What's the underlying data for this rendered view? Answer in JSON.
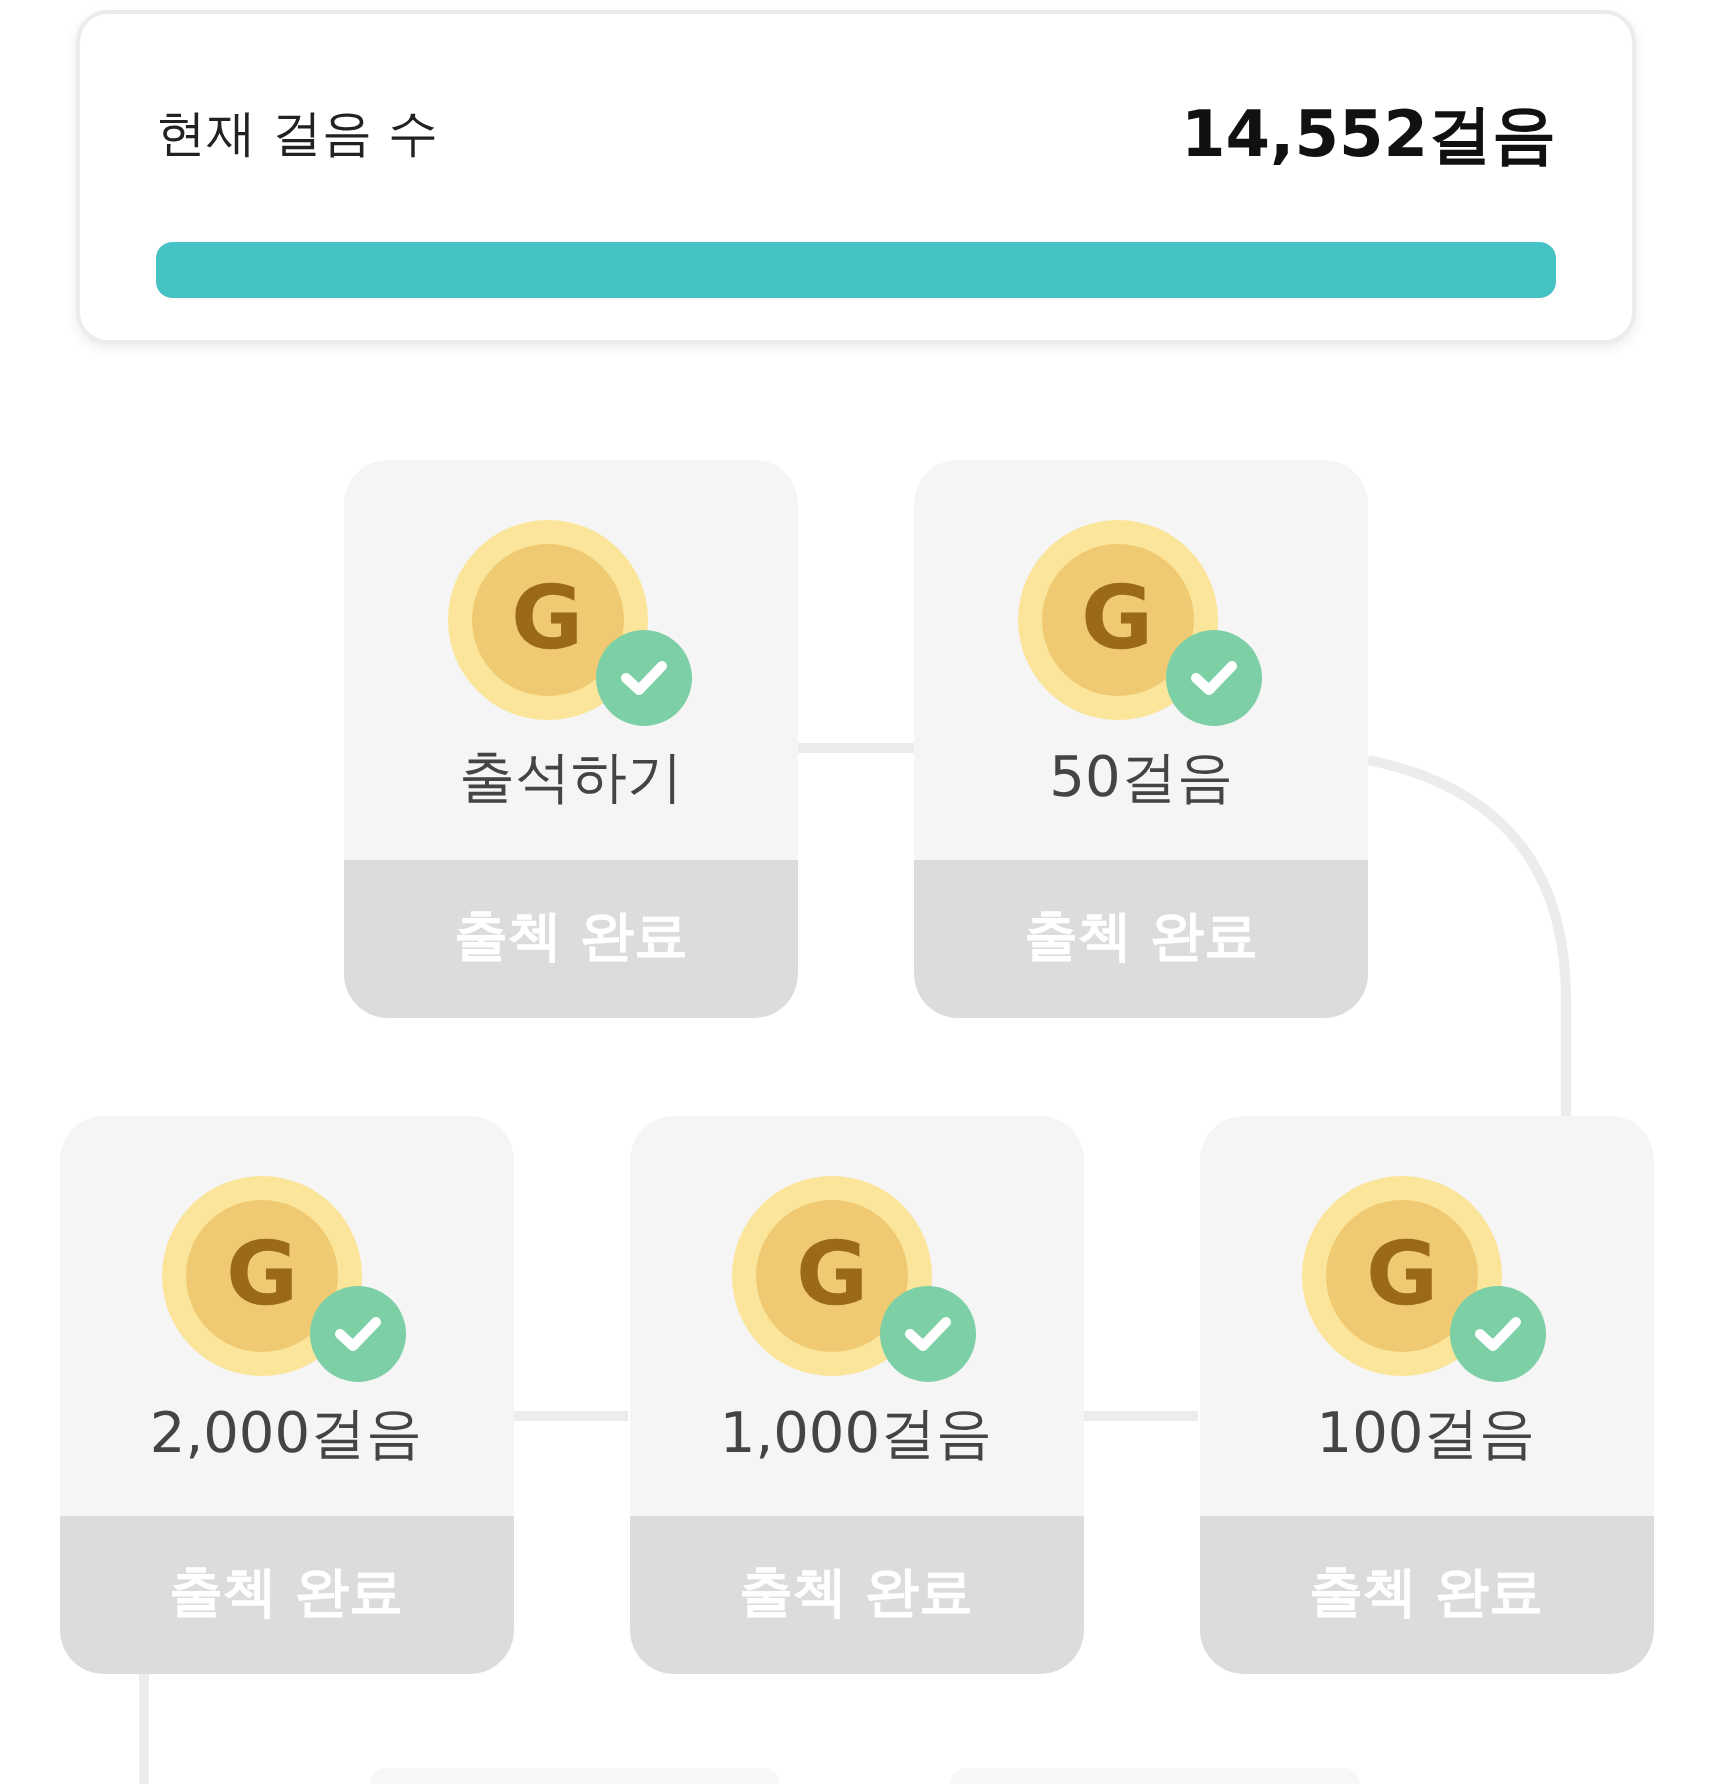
{
  "summary": {
    "label": "현재 걸음 수",
    "value": "14,552걸음",
    "level": 1.0
  },
  "rows": [
    [
      {
        "coin_letter": "G",
        "label": "출석하기",
        "status": "출첵 완료",
        "completed": true
      },
      {
        "coin_letter": "G",
        "label": "50걸음",
        "status": "출첵 완료",
        "completed": true
      }
    ],
    [
      {
        "coin_letter": "G",
        "label": "2,000걸음",
        "status": "출첵 완료",
        "completed": true
      },
      {
        "coin_letter": "G",
        "label": "1,000걸음",
        "status": "출첵 완료",
        "completed": true
      },
      {
        "coin_letter": "G",
        "label": "100걸음",
        "status": "출첵 완료",
        "completed": true
      }
    ]
  ]
}
